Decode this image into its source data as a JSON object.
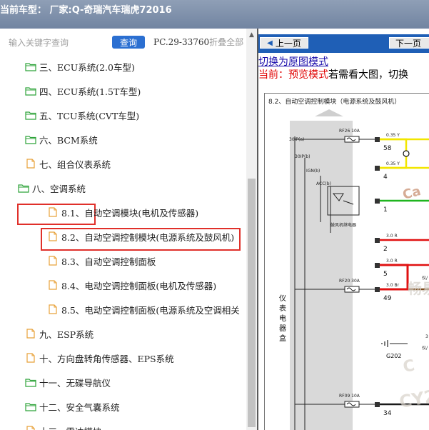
{
  "header": {
    "title": "当前车型： 厂家:Q-奇瑞汽车瑞虎72016"
  },
  "search": {
    "placeholder": "输入关键字查询",
    "button_label": "查询",
    "pc_code": "PC.29-33760",
    "collapse_all": "折叠全部"
  },
  "tree": {
    "items": [
      {
        "label": "三、ECU系统(2.0车型)",
        "icon": "folder-open-icon",
        "color": "#2fa33a"
      },
      {
        "label": "四、ECU系统(1.5T车型)",
        "icon": "folder-open-icon",
        "color": "#2fa33a"
      },
      {
        "label": "五、TCU系统(CVT车型)",
        "icon": "folder-open-icon",
        "color": "#2fa33a"
      },
      {
        "label": "六、BCM系统",
        "icon": "folder-open-icon",
        "color": "#2fa33a"
      },
      {
        "label": "七、组合仪表系统",
        "icon": "document-icon",
        "color": "#e8a23a"
      },
      {
        "label": "八、空调系统",
        "icon": "folder-open-icon",
        "color": "#2fa33a",
        "highlighted": true
      },
      {
        "label": "8.1、自动空调模块(电机及传感器)",
        "icon": "document-icon",
        "color": "#e8a23a"
      },
      {
        "label": "8.2、自动空调控制模块(电源系统及鼓风机)",
        "icon": "document-icon",
        "color": "#e8a23a",
        "highlighted": true
      },
      {
        "label": "8.3、自动空调控制面板",
        "icon": "document-icon",
        "color": "#e8a23a"
      },
      {
        "label": "8.4、电动空调控制面板(电机及传感器)",
        "icon": "document-icon",
        "color": "#e8a23a"
      },
      {
        "label": "8.5、电动空调控制面板(电源系统及空调相关",
        "icon": "document-icon",
        "color": "#e8a23a"
      },
      {
        "label": "九、ESP系统",
        "icon": "document-icon",
        "color": "#e8a23a"
      },
      {
        "label": "十、方向盘转角传感器、EPS系统",
        "icon": "document-icon",
        "color": "#e8a23a"
      },
      {
        "label": "十一、无碟导航仪",
        "icon": "folder-open-icon",
        "color": "#2fa33a"
      },
      {
        "label": "十二、安全气囊系统",
        "icon": "folder-open-icon",
        "color": "#2fa33a"
      },
      {
        "label": "十三、雷达模块",
        "icon": "document-icon",
        "color": "#e8a23a"
      }
    ],
    "highlight_color": "#e0302a"
  },
  "viewer": {
    "prev_label": "上一页",
    "next_label": "下一页",
    "switch_link": "切换为原图模式",
    "preview_mode_label": "当前：预览模式",
    "preview_hint": "若需看大图，切换",
    "diagram": {
      "title": "8.2、自动空调控制模块（电源系统及鼓风机）",
      "fuses": [
        {
          "label": "RF26 10A"
        },
        {
          "label": "RF20 30A"
        },
        {
          "label": "RF09 10A"
        }
      ],
      "pins": [
        "58",
        "4",
        "1",
        "2",
        "5",
        "49",
        "34"
      ],
      "wires": [
        {
          "label": "0.35 Y",
          "color": "#f2e600"
        },
        {
          "label": "0.35 Y",
          "color": "#f2e600"
        },
        {
          "label": "",
          "color": "#1fb51f"
        },
        {
          "label": "3.0 R",
          "color": "#e01010"
        },
        {
          "label": "3.0 R",
          "color": "#e01010"
        },
        {
          "label": "3.0 Br",
          "color": "#7a4a1c"
        },
        {
          "label": "",
          "color": "#1a1a1a"
        }
      ],
      "side_labels": [
        "30IP(a)",
        "30IP(b)",
        "IGN(b)",
        "ACC(b)"
      ],
      "relay_label": "鼓风机继电器",
      "box_label": [
        "仪",
        "表",
        "电",
        "器",
        "盒"
      ],
      "ground_label": "G202",
      "partial_labels": [
        "仪/",
        "仪/",
        "3"
      ],
      "watermark_text": [
        "Ca",
        "畅易",
        "C",
        "CY2"
      ]
    }
  }
}
